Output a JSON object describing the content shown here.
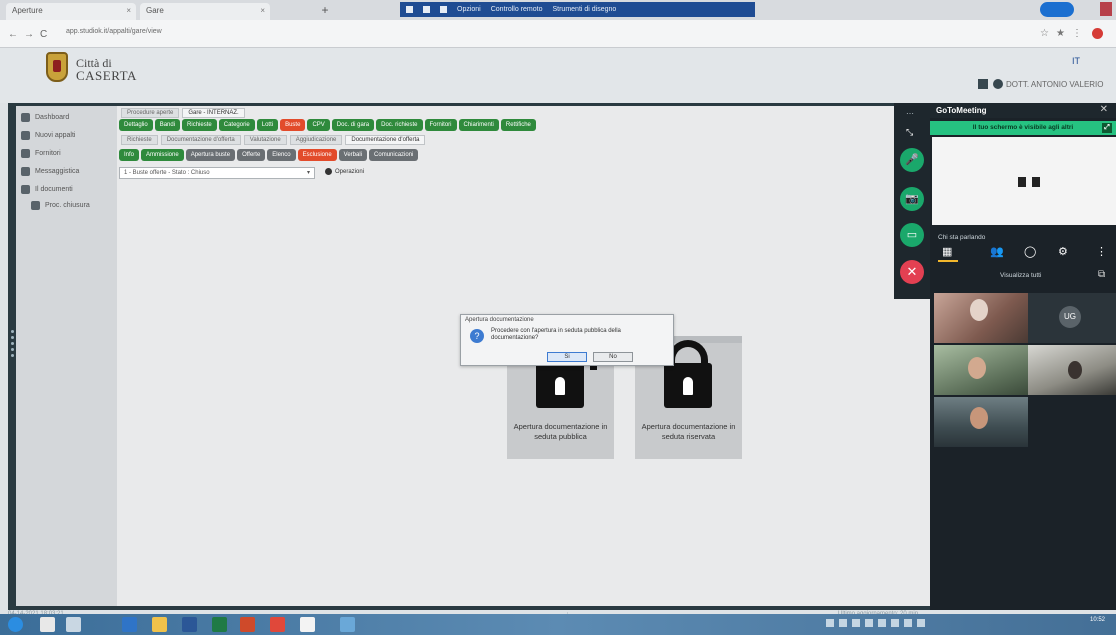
{
  "browser": {
    "tabs": [
      {
        "label": "Aperture",
        "close": "×"
      },
      {
        "label": "Gare",
        "close": "×"
      }
    ],
    "new_tab": "+",
    "share_bar": {
      "menus": [
        "Opzioni",
        "Controllo remoto",
        "Strumenti di disegno"
      ]
    },
    "url": "app.studiok.it/appalti/gare/view",
    "nav": {
      "back": "←",
      "forward": "→",
      "reload": "C"
    },
    "extensions": [
      "☆",
      "★",
      "⋮"
    ]
  },
  "header": {
    "city_line1": "Città di",
    "city_line2": "CASERTA",
    "flag_label": "IT",
    "user_name": "DOTT. ANTONIO VALERIO"
  },
  "sidebar": {
    "items": [
      {
        "label": "Dashboard",
        "icon": "home-icon"
      },
      {
        "label": "Nuovi appalti",
        "icon": "list-icon"
      },
      {
        "label": "Fornitori",
        "icon": "truck-icon"
      },
      {
        "label": "Messaggistica",
        "icon": "chat-icon"
      },
      {
        "label": "Il documenti",
        "icon": "folder-icon"
      }
    ],
    "subitems": [
      {
        "label": "Proc. chiusura",
        "icon": "file-icon"
      }
    ]
  },
  "breadcrumbs_row1": [
    "Procedure aperte",
    "Gare - INTERNAZ."
  ],
  "chips_row1": [
    {
      "label": "Dettaglio",
      "color": "green"
    },
    {
      "label": "Bandi",
      "color": "green"
    },
    {
      "label": "Richieste",
      "color": "green"
    },
    {
      "label": "Categorie",
      "color": "green"
    },
    {
      "label": "Lotti",
      "color": "green"
    },
    {
      "label": "Buste",
      "color": "red"
    },
    {
      "label": "CPV",
      "color": "green"
    },
    {
      "label": "Doc. di gara",
      "color": "green"
    },
    {
      "label": "Doc. richieste",
      "color": "green"
    },
    {
      "label": "Fornitori",
      "color": "green"
    },
    {
      "label": "Chiarimenti",
      "color": "green"
    },
    {
      "label": "Rettifiche",
      "color": "green"
    }
  ],
  "breadcrumbs_row2": [
    "Richieste",
    "Documentazione d'offerta",
    "Valutazione",
    "Aggiudicazione",
    "Documentazione d'offerta"
  ],
  "chips_row2": [
    {
      "label": "Info",
      "color": "green"
    },
    {
      "label": "Ammissione",
      "color": "green"
    },
    {
      "label": "Apertura buste",
      "color": "gray"
    },
    {
      "label": "Offerte",
      "color": "gray"
    },
    {
      "label": "Elenco",
      "color": "gray"
    },
    {
      "label": "Esclusione",
      "color": "red"
    },
    {
      "label": "Verbali",
      "color": "gray"
    },
    {
      "label": "Comunicazioni",
      "color": "gray"
    }
  ],
  "filter": {
    "selected": "1 - Buste offerte - Stato : Chiuso",
    "arrow": "▾",
    "options_label": "Operazioni"
  },
  "cards": [
    {
      "label": "Apertura documentazione in seduta pubblica"
    },
    {
      "label": "Apertura documentazione in seduta riservata"
    }
  ],
  "dialog": {
    "title": "Apertura documentazione",
    "icon": "?",
    "message": "Procedere con l'apertura in seduta pubblica della documentazione?",
    "ok": "Si",
    "cancel": "No"
  },
  "status": {
    "left": "04-14-2021 18:03:21",
    "mid": "↓",
    "right": "Ultimo aggiornamento: 20 min"
  },
  "meeting": {
    "logo": "GoToMeeting",
    "close": "✕",
    "notice": "Il tuo schermo è visibile agli altri",
    "rail_dots": "⋯",
    "rail_expand": "⤡",
    "mic": "🎤",
    "camera": "📷",
    "screen": "▭",
    "end": "✕",
    "speaking_label": "Chi sta parlando",
    "view_all": "Visualizza tutti",
    "tools": [
      "▦",
      "👥",
      "◯",
      "⚙",
      "⋮"
    ],
    "avatar_initials": "UG",
    "ext_icon": "⧉"
  },
  "taskbar": {
    "clock": "10:52"
  }
}
